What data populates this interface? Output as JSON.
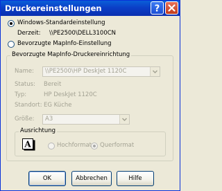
{
  "window": {
    "title": "Druckereinstellungen",
    "help_icon": "question-mark",
    "close_icon": "x"
  },
  "options": {
    "windows_default_label": "Windows-Standardeinstellung",
    "current_label": "Derzeit:",
    "current_value": "\\\\PE2500\\DELL3100CN",
    "mapinfo_pref_label": "Bevorzugte MapInfo-Einstellung"
  },
  "group": {
    "title": "Bevorzugte MapInfo-Druckereinrichtung",
    "name_label": "Name:",
    "name_value": "\\\\PE2500\\HP DeskJet 1120C",
    "status_label": "Status:",
    "status_value": "Bereit",
    "type_label": "Typ:",
    "type_value": "HP DeskJet 1120C",
    "location_label": "Standort:",
    "location_value": "EG Küche",
    "size_label": "Größe:",
    "size_value": "A3"
  },
  "orientation": {
    "title": "Ausrichtung",
    "portrait_label": "Hochformat",
    "landscape_label": "Querformat",
    "selected": "Querformat"
  },
  "buttons": {
    "ok": "OK",
    "cancel": "Abbrechen",
    "help": "Hilfe"
  },
  "colors": {
    "titlebar": "#0b3fc7",
    "dialog_bg": "#ece9d8",
    "disabled_text": "#a3a293"
  }
}
